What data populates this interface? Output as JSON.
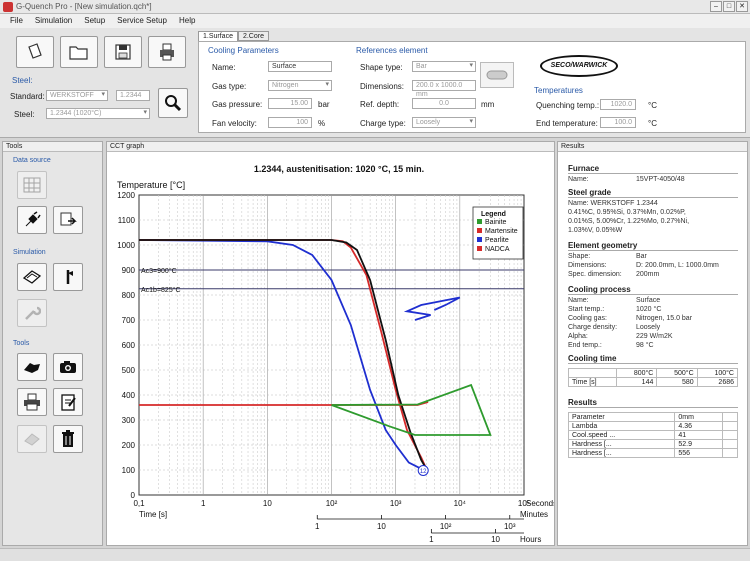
{
  "window": {
    "title": "G-Quench Pro - [New simulation.qch*]"
  },
  "menu": [
    "File",
    "Simulation",
    "Setup",
    "Service Setup",
    "Help"
  ],
  "steel_panel": {
    "title": "Steel:",
    "standard_label": "Standard:",
    "standard_value": "WERKSTOFF",
    "number_value": "1.2344",
    "steel_label": "Steel:",
    "steel_value": "1.2344 (1020°C)"
  },
  "tabs": [
    "1.Surface",
    "2.Core"
  ],
  "cooling": {
    "title": "Cooling Parameters",
    "name_label": "Name:",
    "name_value": "Surface",
    "gas_label": "Gas type:",
    "gas_value": "Nitrogen",
    "pressure_label": "Gas pressure:",
    "pressure_value": "15.00",
    "pressure_unit": "bar",
    "fan_label": "Fan velocity:",
    "fan_value": "100",
    "fan_unit": "%"
  },
  "reference": {
    "title": "References element",
    "shape_label": "Shape type:",
    "shape_value": "Bar",
    "dim_label": "Dimensions:",
    "dim_value": "200.0 x 1000.0 mm",
    "depth_label": "Ref. depth:",
    "depth_value": "0.0",
    "depth_unit": "mm",
    "charge_label": "Charge type:",
    "charge_value": "Loosely"
  },
  "logo": "SECO/WARWICK",
  "temperatures": {
    "title": "Temperatures",
    "quench_label": "Quenching temp.:",
    "quench_value": "1020.0",
    "quench_unit": "°C",
    "end_label": "End temperature:",
    "end_value": "100.0",
    "end_unit": "°C"
  },
  "tools_pane": {
    "title": "Tools",
    "data_source": "Data source",
    "simulation": "Simulation",
    "tools": "Tools"
  },
  "icons": [
    "open-doc-icon",
    "folder-icon",
    "save-icon",
    "print-icon",
    "search-icon",
    "grid-icon",
    "plug-icon",
    "export-icon",
    "quench-icon",
    "tool-icon",
    "wrench-icon",
    "hand-icon",
    "camera-icon",
    "printer-icon",
    "clipboard-icon",
    "eraser-icon",
    "trash-icon"
  ],
  "graph_pane": {
    "title": "CCT graph"
  },
  "chart_data": {
    "type": "line",
    "title": "1.2344, austenitisation: 1020 °C, 15 min.",
    "ylabel": "Temperature [°C]",
    "ylim": [
      0,
      1200
    ],
    "yticks": [
      0,
      100,
      200,
      300,
      400,
      500,
      600,
      700,
      800,
      900,
      1000,
      1100,
      1200
    ],
    "xlim": [
      0.1,
      100000
    ],
    "xscale": "log",
    "xticks_seconds": [
      "0,1",
      "1",
      "10",
      "10²",
      "10³",
      "10⁴",
      "10⁵"
    ],
    "xlabel_seconds": "Seconds",
    "x_time_label": "Time [s]",
    "minutes_ticks": [
      {
        "label": "1",
        "s": 60
      },
      {
        "label": "10",
        "s": 600
      },
      {
        "label": "10²",
        "s": 6000
      },
      {
        "label": "10³",
        "s": 60000
      }
    ],
    "minutes_label": "Minutes",
    "hours_ticks": [
      {
        "label": "1",
        "s": 3600
      },
      {
        "label": "10",
        "s": 36000
      }
    ],
    "hours_label": "Hours",
    "hlines": [
      {
        "label": "Ac3=900°C",
        "y": 900
      },
      {
        "label": "Ac1b=825°C",
        "y": 825
      }
    ],
    "legend_title": "Legend",
    "legend": [
      {
        "name": "Bainite",
        "color": "#2e9b2e"
      },
      {
        "name": "Martensite",
        "color": "#d62a2a"
      },
      {
        "name": "Pearlite",
        "color": "#1f2fd0"
      },
      {
        "name": "NADCA",
        "color": "#d62a2a"
      }
    ],
    "marker_label": "12",
    "series": [
      {
        "id": "pearlite",
        "color": "#1f2fd0",
        "points": [
          [
            0.1,
            1020
          ],
          [
            10,
            1015
          ],
          [
            25,
            1000
          ],
          [
            50,
            960
          ],
          [
            100,
            860
          ],
          [
            200,
            680
          ],
          [
            400,
            420
          ],
          [
            700,
            260
          ],
          [
            1000,
            200
          ],
          [
            1600,
            130
          ],
          [
            2500,
            105
          ]
        ]
      },
      {
        "id": "martensite",
        "color": "#d62a2a",
        "points": [
          [
            0.1,
            1020
          ],
          [
            100,
            1020
          ],
          [
            150,
            1015
          ],
          [
            200,
            990
          ],
          [
            350,
            880
          ],
          [
            600,
            650
          ],
          [
            1000,
            420
          ],
          [
            1500,
            260
          ],
          [
            2500,
            150
          ],
          [
            3000,
            105
          ]
        ]
      },
      {
        "id": "nadca",
        "color": "#111111",
        "points": [
          [
            0.1,
            1020
          ],
          [
            100,
            1020
          ],
          [
            170,
            1010
          ],
          [
            250,
            980
          ],
          [
            400,
            860
          ],
          [
            700,
            620
          ],
          [
            1100,
            400
          ],
          [
            1700,
            250
          ],
          [
            2500,
            140
          ],
          [
            3000,
            105
          ]
        ]
      },
      {
        "id": "bainite-ms",
        "color": "#d62a2a",
        "points": [
          [
            0.1,
            360
          ],
          [
            2200,
            360
          ],
          [
            3200,
            372
          ]
        ]
      },
      {
        "id": "bainite",
        "color": "#2e9b2e",
        "points": [
          [
            100,
            360
          ],
          [
            800,
            275
          ],
          [
            2000,
            240
          ],
          [
            30000,
            240
          ],
          [
            15000,
            440
          ],
          [
            2200,
            362
          ],
          [
            100,
            360
          ]
        ]
      },
      {
        "id": "pearlite-nose",
        "color": "#1f2fd0",
        "points": [
          [
            2000,
            700
          ],
          [
            3500,
            720
          ],
          [
            1500,
            735
          ],
          [
            2500,
            760
          ],
          [
            10000,
            790
          ],
          [
            6000,
            760
          ],
          [
            4000,
            740
          ]
        ]
      }
    ]
  },
  "results": {
    "title": "Results",
    "furnace_h": "Furnace",
    "furnace_name_label": "Name:",
    "furnace_name_value": "15VPT-4050/48",
    "steel_h": "Steel grade",
    "steel_name": "Name: WERKSTOFF 1.2344",
    "steel_comp1": "0.41%C, 0.95%Si, 0.37%Mn, 0.02%P,",
    "steel_comp2": "0.01%S, 5.00%Cr, 1.22%Mo, 0.27%Ni,",
    "steel_comp3": "1.03%V, 0.05%W",
    "geom_h": "Element geometry",
    "geom_shape_label": "Shape:",
    "geom_shape_value": "Bar",
    "geom_dim_label": "Dimensions:",
    "geom_dim_value": "D: 200.0mm, L: 1000.0mm",
    "geom_spec_label": "Spec. dimension:",
    "geom_spec_value": "200mm",
    "proc_h": "Cooling process",
    "proc_name_label": "Name:",
    "proc_name_value": "Surface",
    "proc_start_label": "Start temp.:",
    "proc_start_value": "1020 °C",
    "proc_gas_label": "Cooling gas:",
    "proc_gas_value": "Nitrogen, 15.0 bar",
    "proc_charge_label": "Charge density:",
    "proc_charge_value": "Loosely",
    "proc_alpha_label": "Alpha:",
    "proc_alpha_value": "229 W/m2K",
    "proc_end_label": "End temp.:",
    "proc_end_value": "98 °C",
    "ct_h": "Cooling time",
    "ct_head": [
      "",
      "800°C",
      "500°C",
      "100°C"
    ],
    "ct_row": [
      "Time [s]",
      "144",
      "580",
      "2686"
    ],
    "res_h": "Results",
    "res_head": [
      "Parameter",
      "0mm"
    ],
    "res_rows": [
      [
        "Lambda",
        "4.36"
      ],
      [
        "Cool.speed ...",
        "41"
      ],
      [
        "Hardness [...",
        "52.9"
      ],
      [
        "Hardness [...",
        "556"
      ]
    ]
  }
}
